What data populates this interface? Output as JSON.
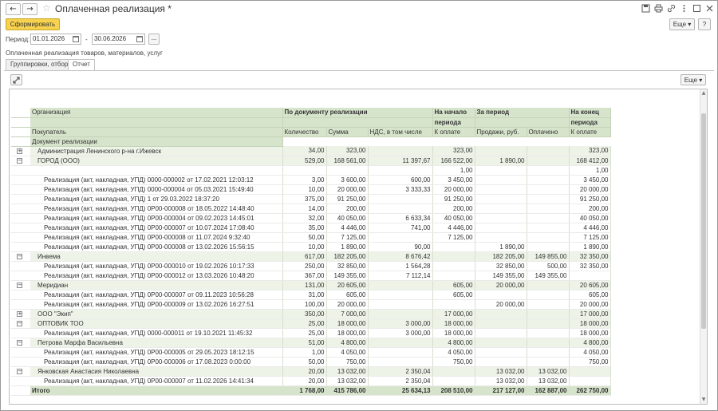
{
  "window": {
    "title": "Оплаченная реализация *",
    "back_icon": "←",
    "forward_icon": "→",
    "star_icon": "☆"
  },
  "toolbar": {
    "generate_label": "Сформировать",
    "more_label": "Еще ▾",
    "help_label": "?"
  },
  "period": {
    "label": "Период:",
    "from": "01.01.2026",
    "dash": "-",
    "to": "30.06.2026",
    "choose_label": "..."
  },
  "report_name": "Оплаченная реализация товаров, материалов, услуг",
  "tabs": [
    {
      "label": "Группировки, отборы"
    },
    {
      "label": "Отчет"
    }
  ],
  "report_toolbar": {
    "more_label": "Еще ▾"
  },
  "headers": {
    "org": "Организация",
    "by_doc": "По документу реализации",
    "start_1": "На начало",
    "start_2": "периода",
    "for_period": "За период",
    "end_1": "На конец",
    "end_2": "периода",
    "buyer": "Покупатель",
    "doc": "Документ реализации",
    "qty": "Количество",
    "sum": "Сумма",
    "vat": "НДС, в том числе",
    "to_pay_start": "К оплате",
    "sales": "Продажи, руб.",
    "paid": "Оплачено",
    "to_pay_end": "К оплате"
  },
  "rows": [
    {
      "level": 1,
      "toggle": "+",
      "name": "Администрация Ленинского р-на г.Ижевск",
      "qty": "34,00",
      "sum": "323,00",
      "vat": "",
      "start": "323,00",
      "sales": "",
      "paid": "",
      "end": "323,00"
    },
    {
      "level": 1,
      "toggle": "−",
      "name": "ГОРОД (ООО)",
      "qty": "529,00",
      "sum": "168 561,00",
      "vat": "11 397,67",
      "start": "166 522,00",
      "sales": "1 890,00",
      "paid": "",
      "end": "168 412,00"
    },
    {
      "level": 2,
      "toggle": "",
      "name": "",
      "qty": "",
      "sum": "",
      "vat": "",
      "start": "1,00",
      "sales": "",
      "paid": "",
      "end": "1,00"
    },
    {
      "level": 2,
      "toggle": "",
      "name": "Реализация (акт, накладная, УПД) 0000-000002 от 17.02.2021 12:03:12",
      "qty": "3,00",
      "sum": "3 600,00",
      "vat": "600,00",
      "start": "3 450,00",
      "sales": "",
      "paid": "",
      "end": "3 450,00"
    },
    {
      "level": 2,
      "toggle": "",
      "name": "Реализация (акт, накладная, УПД) 0000-000004 от 05.03.2021 15:49:40",
      "qty": "10,00",
      "sum": "20 000,00",
      "vat": "3 333,33",
      "start": "20 000,00",
      "sales": "",
      "paid": "",
      "end": "20 000,00"
    },
    {
      "level": 2,
      "toggle": "",
      "name": "Реализация (акт, накладная, УПД) 1 от 29.03.2022 18:37:20",
      "qty": "375,00",
      "sum": "91 250,00",
      "vat": "",
      "start": "91 250,00",
      "sales": "",
      "paid": "",
      "end": "91 250,00"
    },
    {
      "level": 2,
      "toggle": "",
      "name": "Реализация (акт, накладная, УПД) 0Р00-000008 от 18.05.2022 14:48:40",
      "qty": "14,00",
      "sum": "200,00",
      "vat": "",
      "start": "200,00",
      "sales": "",
      "paid": "",
      "end": "200,00"
    },
    {
      "level": 2,
      "toggle": "",
      "name": "Реализация (акт, накладная, УПД) 0Р00-000004 от 09.02.2023 14:45:01",
      "qty": "32,00",
      "sum": "40 050,00",
      "vat": "6 633,34",
      "start": "40 050,00",
      "sales": "",
      "paid": "",
      "end": "40 050,00"
    },
    {
      "level": 2,
      "toggle": "",
      "name": "Реализация (акт, накладная, УПД) 0Р00-000007 от 10.07.2024 17:08:40",
      "qty": "35,00",
      "sum": "4 446,00",
      "vat": "741,00",
      "start": "4 446,00",
      "sales": "",
      "paid": "",
      "end": "4 446,00"
    },
    {
      "level": 2,
      "toggle": "",
      "name": "Реализация (акт, накладная, УПД) 0Р00-000008 от 11.07.2024 9:32:40",
      "qty": "50,00",
      "sum": "7 125,00",
      "vat": "",
      "start": "7 125,00",
      "sales": "",
      "paid": "",
      "end": "7 125,00"
    },
    {
      "level": 2,
      "toggle": "",
      "name": "Реализация (акт, накладная, УПД) 0Р00-000008 от 13.02.2026 15:56:15",
      "qty": "10,00",
      "sum": "1 890,00",
      "vat": "90,00",
      "start": "",
      "sales": "1 890,00",
      "paid": "",
      "end": "1 890,00"
    },
    {
      "level": 1,
      "toggle": "−",
      "name": "Инвема",
      "qty": "617,00",
      "sum": "182 205,00",
      "vat": "8 676,42",
      "start": "",
      "sales": "182 205,00",
      "paid": "149 855,00",
      "end": "32 350,00"
    },
    {
      "level": 2,
      "toggle": "",
      "name": "Реализация (акт, накладная, УПД) 0Р00-000010 от 19.02.2026 10:17:33",
      "qty": "250,00",
      "sum": "32 850,00",
      "vat": "1 564,28",
      "start": "",
      "sales": "32 850,00",
      "paid": "500,00",
      "end": "32 350,00"
    },
    {
      "level": 2,
      "toggle": "",
      "name": "Реализация (акт, накладная, УПД) 0Р00-000012 от 13.03.2026 10:48:20",
      "qty": "367,00",
      "sum": "149 355,00",
      "vat": "7 112,14",
      "start": "",
      "sales": "149 355,00",
      "paid": "149 355,00",
      "end": ""
    },
    {
      "level": 1,
      "toggle": "−",
      "name": "Меридиан",
      "qty": "131,00",
      "sum": "20 605,00",
      "vat": "",
      "start": "605,00",
      "sales": "20 000,00",
      "paid": "",
      "end": "20 605,00"
    },
    {
      "level": 2,
      "toggle": "",
      "name": "Реализация (акт, накладная, УПД) 0Р00-000007 от 09.11.2023 10:56:28",
      "qty": "31,00",
      "sum": "605,00",
      "vat": "",
      "start": "605,00",
      "sales": "",
      "paid": "",
      "end": "605,00"
    },
    {
      "level": 2,
      "toggle": "",
      "name": "Реализация (акт, накладная, УПД) 0Р00-000009 от 13.02.2026 16:27:51",
      "qty": "100,00",
      "sum": "20 000,00",
      "vat": "",
      "start": "",
      "sales": "20 000,00",
      "paid": "",
      "end": "20 000,00"
    },
    {
      "level": 1,
      "toggle": "+",
      "name": "ООО \"Экип\"",
      "qty": "350,00",
      "sum": "7 000,00",
      "vat": "",
      "start": "17 000,00",
      "sales": "",
      "paid": "",
      "end": "17 000,00"
    },
    {
      "level": 1,
      "toggle": "−",
      "name": "ОПТОВИК ТОО",
      "qty": "25,00",
      "sum": "18 000,00",
      "vat": "3 000,00",
      "start": "18 000,00",
      "sales": "",
      "paid": "",
      "end": "18 000,00"
    },
    {
      "level": 2,
      "toggle": "",
      "name": "Реализация (акт, накладная, УПД) 0000-000011 от 19.10.2021 11:45:32",
      "qty": "25,00",
      "sum": "18 000,00",
      "vat": "3 000,00",
      "start": "18 000,00",
      "sales": "",
      "paid": "",
      "end": "18 000,00"
    },
    {
      "level": 1,
      "toggle": "−",
      "name": "Петрова Марфа Васильевна",
      "qty": "51,00",
      "sum": "4 800,00",
      "vat": "",
      "start": "4 800,00",
      "sales": "",
      "paid": "",
      "end": "4 800,00"
    },
    {
      "level": 2,
      "toggle": "",
      "name": "Реализация (акт, накладная, УПД) 0Р00-000005 от 29.05.2023 18:12:15",
      "qty": "1,00",
      "sum": "4 050,00",
      "vat": "",
      "start": "4 050,00",
      "sales": "",
      "paid": "",
      "end": "4 050,00"
    },
    {
      "level": 2,
      "toggle": "",
      "name": "Реализация (акт, накладная, УПД) 0Р00-000006 от 17.08.2023 0:00:00",
      "qty": "50,00",
      "sum": "750,00",
      "vat": "",
      "start": "750,00",
      "sales": "",
      "paid": "",
      "end": "750,00"
    },
    {
      "level": 1,
      "toggle": "−",
      "name": "Янковская Анастасия Николаевна",
      "qty": "20,00",
      "sum": "13 032,00",
      "vat": "2 350,04",
      "start": "",
      "sales": "13 032,00",
      "paid": "13 032,00",
      "end": ""
    },
    {
      "level": 2,
      "toggle": "",
      "name": "Реализация (акт, накладная, УПД) 0Р00-000007 от 11.02.2026 14:41:34",
      "qty": "20,00",
      "sum": "13 032,00",
      "vat": "2 350,04",
      "start": "",
      "sales": "13 032,00",
      "paid": "13 032,00",
      "end": ""
    }
  ],
  "total": {
    "name": "Итого",
    "qty": "1 768,00",
    "sum": "415 786,00",
    "vat": "25 634,13",
    "start": "208 510,00",
    "sales": "217 127,00",
    "paid": "162 887,00",
    "end": "262 750,00"
  },
  "colors": {
    "header_bg": "#d7e4cc",
    "group_bg": "#eef3e8",
    "primary_button": "#f6d24e"
  }
}
